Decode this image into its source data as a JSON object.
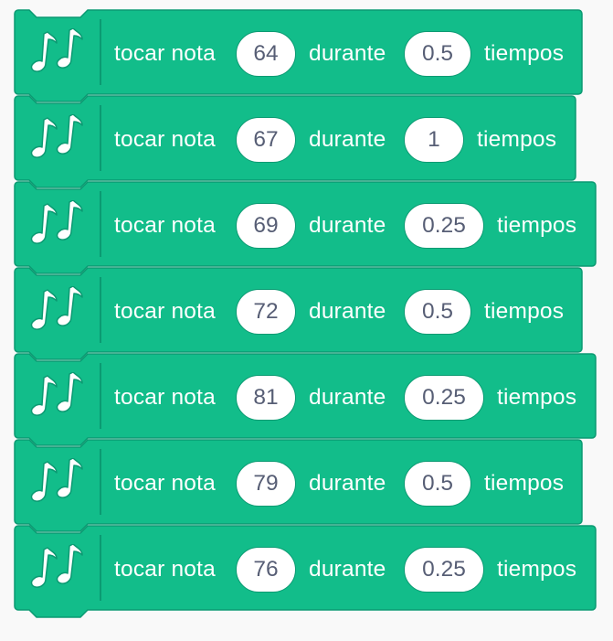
{
  "colors": {
    "block_fill": "#12bd8a",
    "block_stroke": "#0b9a72",
    "input_fill": "#ffffff",
    "input_text": "#575e75",
    "label_text": "#ffffff",
    "background": "#f9f9f9"
  },
  "icon": "music-notes-icon",
  "labels": {
    "play_note": "tocar nota",
    "for": "durante",
    "beats": "tiempos"
  },
  "blocks": [
    {
      "note": "64",
      "beats": "0.5"
    },
    {
      "note": "67",
      "beats": "1"
    },
    {
      "note": "69",
      "beats": "0.25"
    },
    {
      "note": "72",
      "beats": "0.5"
    },
    {
      "note": "81",
      "beats": "0.25"
    },
    {
      "note": "79",
      "beats": "0.5"
    },
    {
      "note": "76",
      "beats": "0.25"
    }
  ]
}
